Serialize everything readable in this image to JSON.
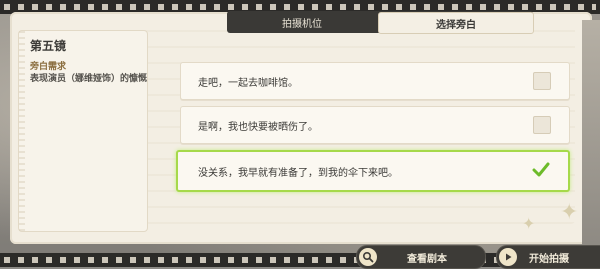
{
  "tabs": {
    "camera_label": "拍摄机位",
    "narration_label": "选择旁白",
    "active": "narration"
  },
  "scene": {
    "title": "第五镜",
    "requirement_label": "旁白需求",
    "requirement_text": "表现演员（娜维娅饰）的慷慨"
  },
  "options": [
    {
      "text": "走吧，一起去咖啡馆。",
      "selected": false
    },
    {
      "text": "是啊，我也快要被晒伤了。",
      "selected": false
    },
    {
      "text": "没关系，我早就有准备了，到我的伞下来吧。",
      "selected": true
    }
  ],
  "buttons": {
    "view_script_label": "查看剧本",
    "start_shoot_label": "开始拍摄"
  },
  "colors": {
    "selected_border": "#a6d94a",
    "check": "#6dbb2a",
    "dark_panel": "#3a3936",
    "paper": "#f3eee3"
  },
  "icons": {
    "view_script": "magnifier-icon",
    "start_shoot": "play-icon",
    "selected": "check-icon"
  }
}
